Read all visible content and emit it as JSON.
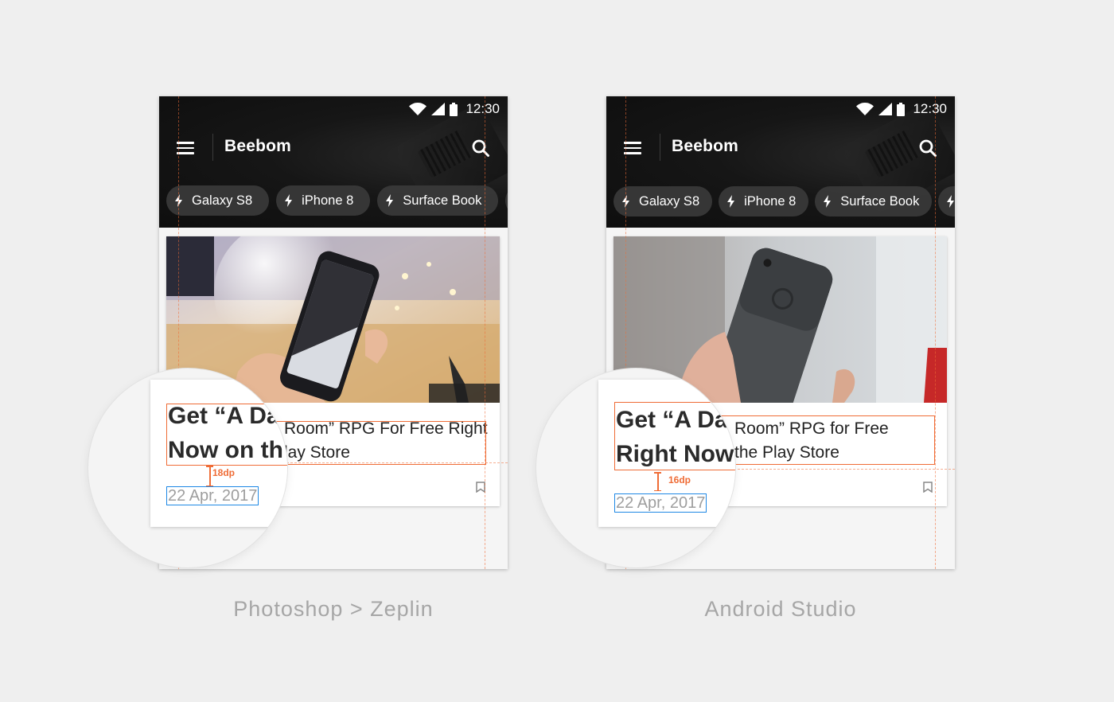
{
  "status_bar": {
    "time": "12:30"
  },
  "app": {
    "brand": "Beebom"
  },
  "chips": [
    "Galaxy S8",
    "iPhone 8",
    "Surface Book"
  ],
  "left": {
    "card_title": "Get “A Dark Room” RPG For Free Right Now on the Play Store",
    "card_title_visible": "Room” RPG For Free Right\nlay Store",
    "mag_title_line1": "Get “A Da",
    "mag_title_line2": "Now on th",
    "date": "22 Apr, 2017",
    "spacing": "18dp",
    "caption": "Photoshop > Zeplin"
  },
  "right": {
    "card_title": "Get “A Dark Room” RPG for Free Right Now on the Play Store",
    "card_title_visible": "Room” RPG for Free\nthe Play Store",
    "mag_title_line1": "Get “A Da",
    "mag_title_line2": "Right Now",
    "date": "22 Apr, 2017",
    "spacing": "16dp",
    "caption": "Android Studio"
  },
  "icons": {
    "menu": "hamburger-icon",
    "search": "search-icon",
    "chip": "bolt-icon",
    "bookmark": "bookmark-icon",
    "wifi": "wifi-icon",
    "signal": "signal-icon",
    "battery": "battery-icon"
  },
  "colors": {
    "redline": "#ef6c36",
    "date_box": "#1e88e5",
    "appbar": "#111111"
  }
}
